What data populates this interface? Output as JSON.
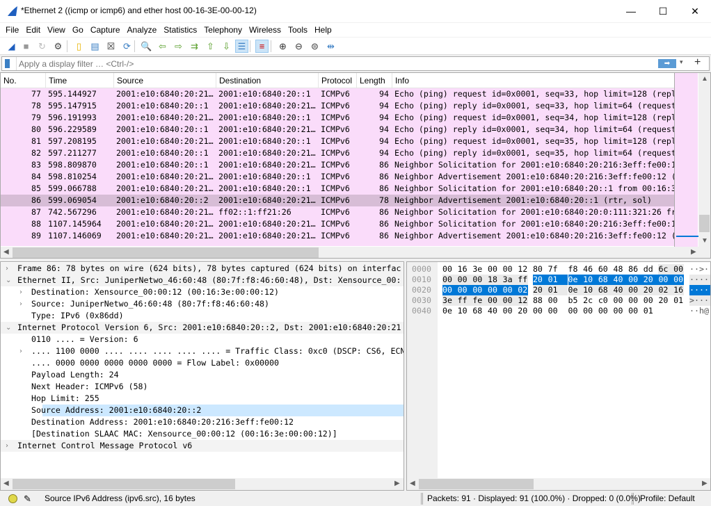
{
  "window": {
    "title": "*Ethernet 2 ((icmp or icmp6) and ether host 00-16-3E-00-00-12)",
    "minimize": "—",
    "maximize": "☐",
    "close": "✕"
  },
  "menu": [
    "File",
    "Edit",
    "View",
    "Go",
    "Capture",
    "Analyze",
    "Statistics",
    "Telephony",
    "Wireless",
    "Tools",
    "Help"
  ],
  "toolbar": [
    {
      "icon": "shark-fin-start-icon",
      "glyph": "◢",
      "color": "#1f5fbf"
    },
    {
      "icon": "stop-icon",
      "glyph": "■",
      "color": "#999"
    },
    {
      "icon": "restart-icon",
      "glyph": "↻",
      "color": "#bbb"
    },
    {
      "icon": "capture-options-gear-icon",
      "glyph": "⚙",
      "color": "#444"
    },
    {
      "icon": "open-file-icon",
      "glyph": "▯",
      "color": "#e8b400"
    },
    {
      "icon": "save-file-icon",
      "glyph": "▤",
      "color": "#3b7fc4"
    },
    {
      "icon": "close-file-icon",
      "glyph": "☒",
      "color": "#333"
    },
    {
      "icon": "reload-file-icon",
      "glyph": "⟳",
      "color": "#3b7fc4"
    },
    {
      "icon": "find-packet-icon",
      "glyph": "🔍",
      "color": "#333"
    },
    {
      "icon": "go-back-icon",
      "glyph": "⇦",
      "color": "#5aa02c"
    },
    {
      "icon": "go-forward-icon",
      "glyph": "⇨",
      "color": "#5aa02c"
    },
    {
      "icon": "go-to-packet-icon",
      "glyph": "⇉",
      "color": "#5aa02c"
    },
    {
      "icon": "first-packet-icon",
      "glyph": "⇧",
      "color": "#5aa02c"
    },
    {
      "icon": "last-packet-icon",
      "glyph": "⇩",
      "color": "#5aa02c"
    },
    {
      "icon": "auto-scroll-icon",
      "glyph": "☰",
      "color": "#3b7fc4",
      "active": true
    },
    {
      "icon": "colorize-icon",
      "glyph": "≡",
      "color": "#c00",
      "active": true
    },
    {
      "icon": "zoom-in-icon",
      "glyph": "⊕",
      "color": "#333"
    },
    {
      "icon": "zoom-out-icon",
      "glyph": "⊖",
      "color": "#333"
    },
    {
      "icon": "normal-size-icon",
      "glyph": "⊜",
      "color": "#333"
    },
    {
      "icon": "resize-columns-icon",
      "glyph": "⇹",
      "color": "#3b7fc4"
    }
  ],
  "filter": {
    "placeholder": "Apply a display filter … <Ctrl-/>",
    "apply": "➡",
    "dropdown": "▾",
    "add": "+"
  },
  "packet_list": {
    "columns": [
      "No.",
      "Time",
      "Source",
      "Destination",
      "Protocol",
      "Length",
      "Info"
    ],
    "selected_no": "86",
    "rows": [
      [
        "77",
        "595.144927",
        "2001:e10:6840:20:21…",
        "2001:e10:6840:20::1",
        "ICMPv6",
        "94",
        "Echo (ping) request id=0x0001, seq=33, hop limit=128 (repl"
      ],
      [
        "78",
        "595.147915",
        "2001:e10:6840:20::1",
        "2001:e10:6840:20:21…",
        "ICMPv6",
        "94",
        "Echo (ping) reply id=0x0001, seq=33, hop limit=64 (request"
      ],
      [
        "79",
        "596.191993",
        "2001:e10:6840:20:21…",
        "2001:e10:6840:20::1",
        "ICMPv6",
        "94",
        "Echo (ping) request id=0x0001, seq=34, hop limit=128 (repl"
      ],
      [
        "80",
        "596.229589",
        "2001:e10:6840:20::1",
        "2001:e10:6840:20:21…",
        "ICMPv6",
        "94",
        "Echo (ping) reply id=0x0001, seq=34, hop limit=64 (request"
      ],
      [
        "81",
        "597.208195",
        "2001:e10:6840:20:21…",
        "2001:e10:6840:20::1",
        "ICMPv6",
        "94",
        "Echo (ping) request id=0x0001, seq=35, hop limit=128 (repl"
      ],
      [
        "82",
        "597.211277",
        "2001:e10:6840:20::1",
        "2001:e10:6840:20:21…",
        "ICMPv6",
        "94",
        "Echo (ping) reply id=0x0001, seq=35, hop limit=64 (request"
      ],
      [
        "83",
        "598.809870",
        "2001:e10:6840:20::1",
        "2001:e10:6840:20:21…",
        "ICMPv6",
        "86",
        "Neighbor Solicitation for 2001:e10:6840:20:216:3eff:fe00:1"
      ],
      [
        "84",
        "598.810254",
        "2001:e10:6840:20:21…",
        "2001:e10:6840:20::1",
        "ICMPv6",
        "86",
        "Neighbor Advertisement 2001:e10:6840:20:216:3eff:fe00:12 ("
      ],
      [
        "85",
        "599.066788",
        "2001:e10:6840:20:21…",
        "2001:e10:6840:20::1",
        "ICMPv6",
        "86",
        "Neighbor Solicitation for 2001:e10:6840:20::1 from 00:16:3"
      ],
      [
        "86",
        "599.069054",
        "2001:e10:6840:20::2",
        "2001:e10:6840:20:21…",
        "ICMPv6",
        "78",
        "Neighbor Advertisement 2001:e10:6840:20::1 (rtr, sol)"
      ],
      [
        "87",
        "742.567296",
        "2001:e10:6840:20:21…",
        "ff02::1:ff21:26",
        "ICMPv6",
        "86",
        "Neighbor Solicitation for 2001:e10:6840:20:0:111:321:26 fr"
      ],
      [
        "88",
        "1107.145964",
        "2001:e10:6840:20:21…",
        "2001:e10:6840:20:21…",
        "ICMPv6",
        "86",
        "Neighbor Solicitation for 2001:e10:6840:20:216:3eff:fe00:1"
      ],
      [
        "89",
        "1107.146069",
        "2001:e10:6840:20:21…",
        "2001:e10:6840:20:21…",
        "ICMPv6",
        "86",
        "Neighbor Advertisement 2001:e10:6840:20:216:3eff:fe00:12 ("
      ]
    ],
    "row_color": "#fadcfa",
    "selected_color": "#d7bdd6"
  },
  "details": [
    {
      "level": 0,
      "exp": "›",
      "text": "Frame 86: 78 bytes on wire (624 bits), 78 bytes captured (624 bits) on interfac",
      "group": true
    },
    {
      "level": 0,
      "exp": "⌄",
      "text": "Ethernet II, Src: JuniperNetwo_46:60:48 (80:7f:f8:46:60:48), Dst: Xensource_00:",
      "group": true
    },
    {
      "level": 1,
      "exp": "›",
      "text": "Destination: Xensource_00:00:12 (00:16:3e:00:00:12)"
    },
    {
      "level": 1,
      "exp": "›",
      "text": "Source: JuniperNetwo_46:60:48 (80:7f:f8:46:60:48)"
    },
    {
      "level": 1,
      "exp": "",
      "text": "Type: IPv6 (0x86dd)"
    },
    {
      "level": 0,
      "exp": "⌄",
      "text": "Internet Protocol Version 6, Src: 2001:e10:6840:20::2, Dst: 2001:e10:6840:20:21",
      "group": true
    },
    {
      "level": 1,
      "exp": "",
      "text": "0110 .... = Version: 6"
    },
    {
      "level": 1,
      "exp": "›",
      "text": ".... 1100 0000 .... .... .... .... .... = Traffic Class: 0xc0 (DSCP: CS6, ECN"
    },
    {
      "level": 1,
      "exp": "",
      "text": ".... 0000 0000 0000 0000 0000 = Flow Label: 0x00000"
    },
    {
      "level": 1,
      "exp": "",
      "text": "Payload Length: 24"
    },
    {
      "level": 1,
      "exp": "",
      "text": "Next Header: ICMPv6 (58)"
    },
    {
      "level": 1,
      "exp": "",
      "text": "Hop Limit: 255"
    },
    {
      "level": 1,
      "exp": "",
      "text": "Source Address: 2001:e10:6840:20::2",
      "selected": true
    },
    {
      "level": 1,
      "exp": "",
      "text": "Destination Address: 2001:e10:6840:20:216:3eff:fe00:12"
    },
    {
      "level": 1,
      "exp": "",
      "text": "[Destination SLAAC MAC: Xensource_00:00:12 (00:16:3e:00:00:12)]"
    },
    {
      "level": 0,
      "exp": "›",
      "text": "Internet Control Message Protocol v6",
      "group": true
    }
  ],
  "hex": [
    {
      "offset": "0000",
      "bytes": [
        "00",
        "16",
        "3e",
        "00",
        "00",
        "12",
        "80",
        "7f",
        "f8",
        "46",
        "60",
        "48",
        "86",
        "dd",
        "6c",
        "00"
      ],
      "ascii": "··>·"
    },
    {
      "offset": "0010",
      "bytes": [
        "00",
        "00",
        "00",
        "18",
        "3a",
        "ff",
        "20",
        "01",
        "0e",
        "10",
        "68",
        "40",
        "00",
        "20",
        "00",
        "00"
      ],
      "ascii": "····"
    },
    {
      "offset": "0020",
      "bytes": [
        "00",
        "00",
        "00",
        "00",
        "00",
        "02",
        "20",
        "01",
        "0e",
        "10",
        "68",
        "40",
        "00",
        "20",
        "02",
        "16"
      ],
      "ascii": "····"
    },
    {
      "offset": "0030",
      "bytes": [
        "3e",
        "ff",
        "fe",
        "00",
        "00",
        "12",
        "88",
        "00",
        "b5",
        "2c",
        "c0",
        "00",
        "00",
        "00",
        "20",
        "01"
      ],
      "ascii": ">···"
    },
    {
      "offset": "0040",
      "bytes": [
        "0e",
        "10",
        "68",
        "40",
        "00",
        "20",
        "00",
        "00",
        "00",
        "00",
        "00",
        "00",
        "00",
        "01"
      ],
      "ascii": "··h@"
    }
  ],
  "status": {
    "message": "Source IPv6 Address (ipv6.src), 16 bytes",
    "stats": "Packets: 91 · Displayed: 91 (100.0%) · Dropped: 0 (0.0%)",
    "profile": "Profile: Default"
  }
}
